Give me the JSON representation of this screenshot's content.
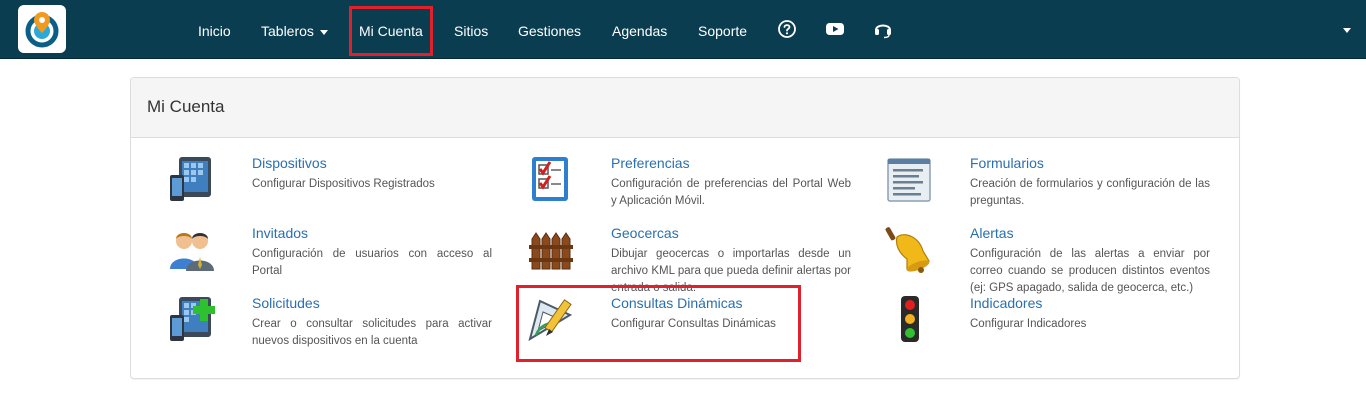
{
  "nav": {
    "items": [
      {
        "label": "Inicio"
      },
      {
        "label": "Tableros"
      },
      {
        "label": "Mi Cuenta"
      },
      {
        "label": "Sitios"
      },
      {
        "label": "Gestiones"
      },
      {
        "label": "Agendas"
      },
      {
        "label": "Soporte"
      }
    ],
    "icons": [
      "help-icon",
      "youtube-icon",
      "headset-icon"
    ],
    "active": "Mi Cuenta"
  },
  "panel": {
    "title": "Mi Cuenta",
    "items": [
      {
        "title": "Dispositivos",
        "desc": "Configurar Dispositivos Registrados",
        "icon": "devices-icon"
      },
      {
        "title": "Preferencias",
        "desc": "Configuración de preferencias del Portal Web y Aplicación Móvil.",
        "icon": "checklist-icon"
      },
      {
        "title": "Formularios",
        "desc": "Creación de formularios y configuración de las preguntas.",
        "icon": "form-icon"
      },
      {
        "title": "Invitados",
        "desc": "Configuración de usuarios con acceso al Portal",
        "icon": "users-icon"
      },
      {
        "title": "Geocercas",
        "desc": "Dibujar geocercas o importarlas desde un archivo KML para que pueda definir alertas por entrada o salida.",
        "icon": "fence-icon"
      },
      {
        "title": "Alertas",
        "desc": "Configuración de las alertas a enviar por correo cuando se producen distintos eventos (ej: GPS apagado, salida de geocerca, etc.)",
        "icon": "bell-icon"
      },
      {
        "title": "Solicitudes",
        "desc": "Crear o consultar solicitudes para activar nuevos dispositivos en la cuenta",
        "icon": "device-add-icon"
      },
      {
        "title": "Consultas Dinámicas",
        "desc": "Configurar Consultas Dinámicas",
        "icon": "pencil-ruler-icon"
      },
      {
        "title": "Indicadores",
        "desc": "Configurar Indicadores",
        "icon": "traffic-light-icon"
      }
    ]
  },
  "colors": {
    "navbar": "#0b3d51",
    "highlight": "#e0202a",
    "link": "#2a6fb0"
  }
}
